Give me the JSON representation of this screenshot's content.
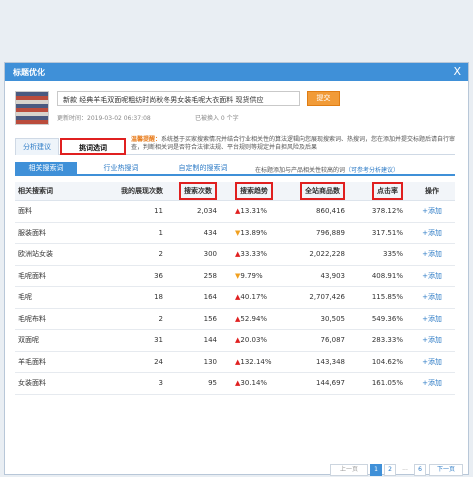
{
  "dialog": {
    "title": "标题优化",
    "close": "X"
  },
  "product": {
    "name": "新款 经典羊毛双面呢粗纺时尚秋冬男女装毛呢大衣面料 现货供应",
    "optimize_button": "提交",
    "update_time": "更新时间：2019-03-02 06:37:08",
    "modified_count": "已被换入 0 个字"
  },
  "tabs": [
    "分析建议",
    "挑词选词"
  ],
  "notice": {
    "lead": "温馨提醒：",
    "text": "系统基于买家搜索情况并结合行业相关性的算法逻辑向您展现搜索词、热搜词，您在添加并提交标题后请自行审查，判断相关词是否符合法律法规、平台规则等规定并自担风险及后果"
  },
  "subtabs": [
    "相关搜索词",
    "行业热搜词",
    "自定制的搜索词"
  ],
  "hint": {
    "text": "在标题添加与产品相关性较高的词",
    "link": "（可参考分析建议）"
  },
  "table": {
    "headers": [
      "相关搜索词",
      "我的展现次数",
      "搜索次数",
      "搜索趋势",
      "全站商品数",
      "点击率",
      "操作"
    ],
    "rows": [
      {
        "word": "面料",
        "impressions": "11",
        "searches": "2,034",
        "trend": "13.31%",
        "dir": "up",
        "products": "860,416",
        "ctr": "378.12%"
      },
      {
        "word": "服装面料",
        "impressions": "1",
        "searches": "434",
        "trend": "13.89%",
        "dir": "down",
        "products": "796,889",
        "ctr": "317.51%"
      },
      {
        "word": "欧洲站女装",
        "impressions": "2",
        "searches": "300",
        "trend": "33.33%",
        "dir": "up",
        "products": "2,022,228",
        "ctr": "335%"
      },
      {
        "word": "毛呢面料",
        "impressions": "36",
        "searches": "258",
        "trend": "9.79%",
        "dir": "down",
        "products": "43,903",
        "ctr": "408.91%"
      },
      {
        "word": "毛呢",
        "impressions": "18",
        "searches": "164",
        "trend": "40.17%",
        "dir": "up",
        "products": "2,707,426",
        "ctr": "115.85%"
      },
      {
        "word": "毛呢布料",
        "impressions": "2",
        "searches": "156",
        "trend": "52.94%",
        "dir": "up",
        "products": "30,505",
        "ctr": "549.36%"
      },
      {
        "word": "双面呢",
        "impressions": "31",
        "searches": "144",
        "trend": "20.03%",
        "dir": "up",
        "products": "76,087",
        "ctr": "283.33%"
      },
      {
        "word": "羊毛面料",
        "impressions": "24",
        "searches": "130",
        "trend": "132.14%",
        "dir": "up",
        "products": "143,348",
        "ctr": "104.62%"
      },
      {
        "word": "女装面料",
        "impressions": "3",
        "searches": "95",
        "trend": "30.14%",
        "dir": "up",
        "products": "144,697",
        "ctr": "161.05%"
      }
    ],
    "add_label": "添加"
  },
  "pager": {
    "prev": "上一页",
    "pages": [
      "1",
      "2"
    ],
    "current": "1",
    "ellipsis": "...",
    "last": "6",
    "next": "下一页"
  },
  "icons": {
    "up": "red-up-arrow-icon",
    "down": "orange-down-arrow-icon",
    "add": "plus-icon"
  },
  "colors": {
    "title_bar": "#3f90d8",
    "highlight": "#e02020",
    "button": "#f19b38"
  }
}
